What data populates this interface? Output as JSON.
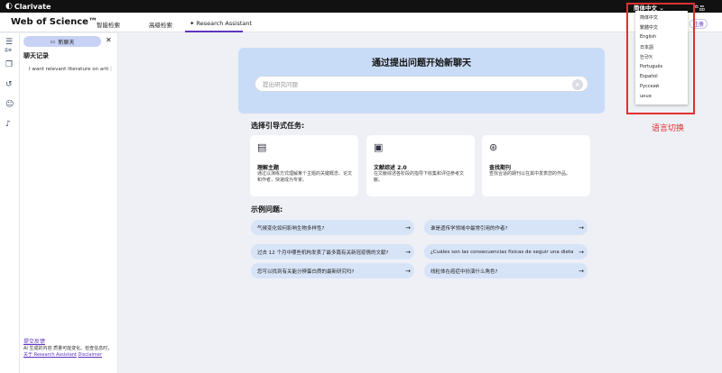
{
  "topbar": {
    "brand": "Clarivate",
    "language_button": "简体中文 ⌄",
    "products": "产品"
  },
  "nav": {
    "app_title": "Web of Science™",
    "tabs": [
      {
        "label": "智能检索"
      },
      {
        "label": "高级检索"
      },
      {
        "label": "Research Assistant"
      }
    ],
    "login_partial": "注册"
  },
  "rail": {
    "items": [
      {
        "icon": "collapse-icon",
        "label": "菜单"
      },
      {
        "icon": "library-icon"
      },
      {
        "icon": "history-icon"
      },
      {
        "icon": "user-icon"
      },
      {
        "icon": "bell-icon"
      }
    ]
  },
  "sidebar": {
    "new_chat": "新聊天",
    "history_title": "聊天记录",
    "history_items": [
      {
        "label": "I want relevant literature on arti"
      }
    ],
    "feedback": "提交反馈",
    "disclaimer_text": "AI 生成的内容 质量可能变化。检查信息时，",
    "disclaimer_link_about": "关于 Research Assistant",
    "disclaimer_link": "Disclaimer"
  },
  "hero": {
    "title": "通过提出问题开始新聊天",
    "input_placeholder": "提出研究问题"
  },
  "tasks": {
    "title": "选择引导式任务:",
    "cards": [
      {
        "title": "理解主题",
        "desc": "通过以演练方式理解某个主题的关键概念、论文和作者，快速成为专家。"
      },
      {
        "title": "文献综述 2.0",
        "desc": "在文献综述各阶段的指导下收集和评估参考文献。"
      },
      {
        "title": "查找期刊",
        "desc": "查找合适的期刊以在其中发表您的作品。"
      }
    ]
  },
  "examples": {
    "title": "示例问题:",
    "items": [
      {
        "label": "气候变化如何影响生物多样性?"
      },
      {
        "label": "谁是遗传学领域中最常引用的作者?"
      },
      {
        "label": "过去 12 个月中哪些机构发表了最多篇有关新冠疫情的文献?"
      },
      {
        "label": "¿Cuáles son las consecuencias físicas de seguir una dieta vegana?"
      },
      {
        "label": "您可以找到有关能分辨蛋白质的最新研究吗?"
      },
      {
        "label": "线粒体在癌症中扮演什么角色?"
      }
    ]
  },
  "language_menu": {
    "options": [
      "简体中文",
      "繁體中文",
      "English",
      "日本語",
      "한국어",
      "Português",
      "Español",
      "Русский",
      "uнuǝ"
    ]
  },
  "annotation": {
    "label": "语言切换",
    "color": "#e03030"
  },
  "colors": {
    "accent": "#5e33bf",
    "hero_bg": "#c9dcf7",
    "example_bg": "#d7e4f8"
  }
}
